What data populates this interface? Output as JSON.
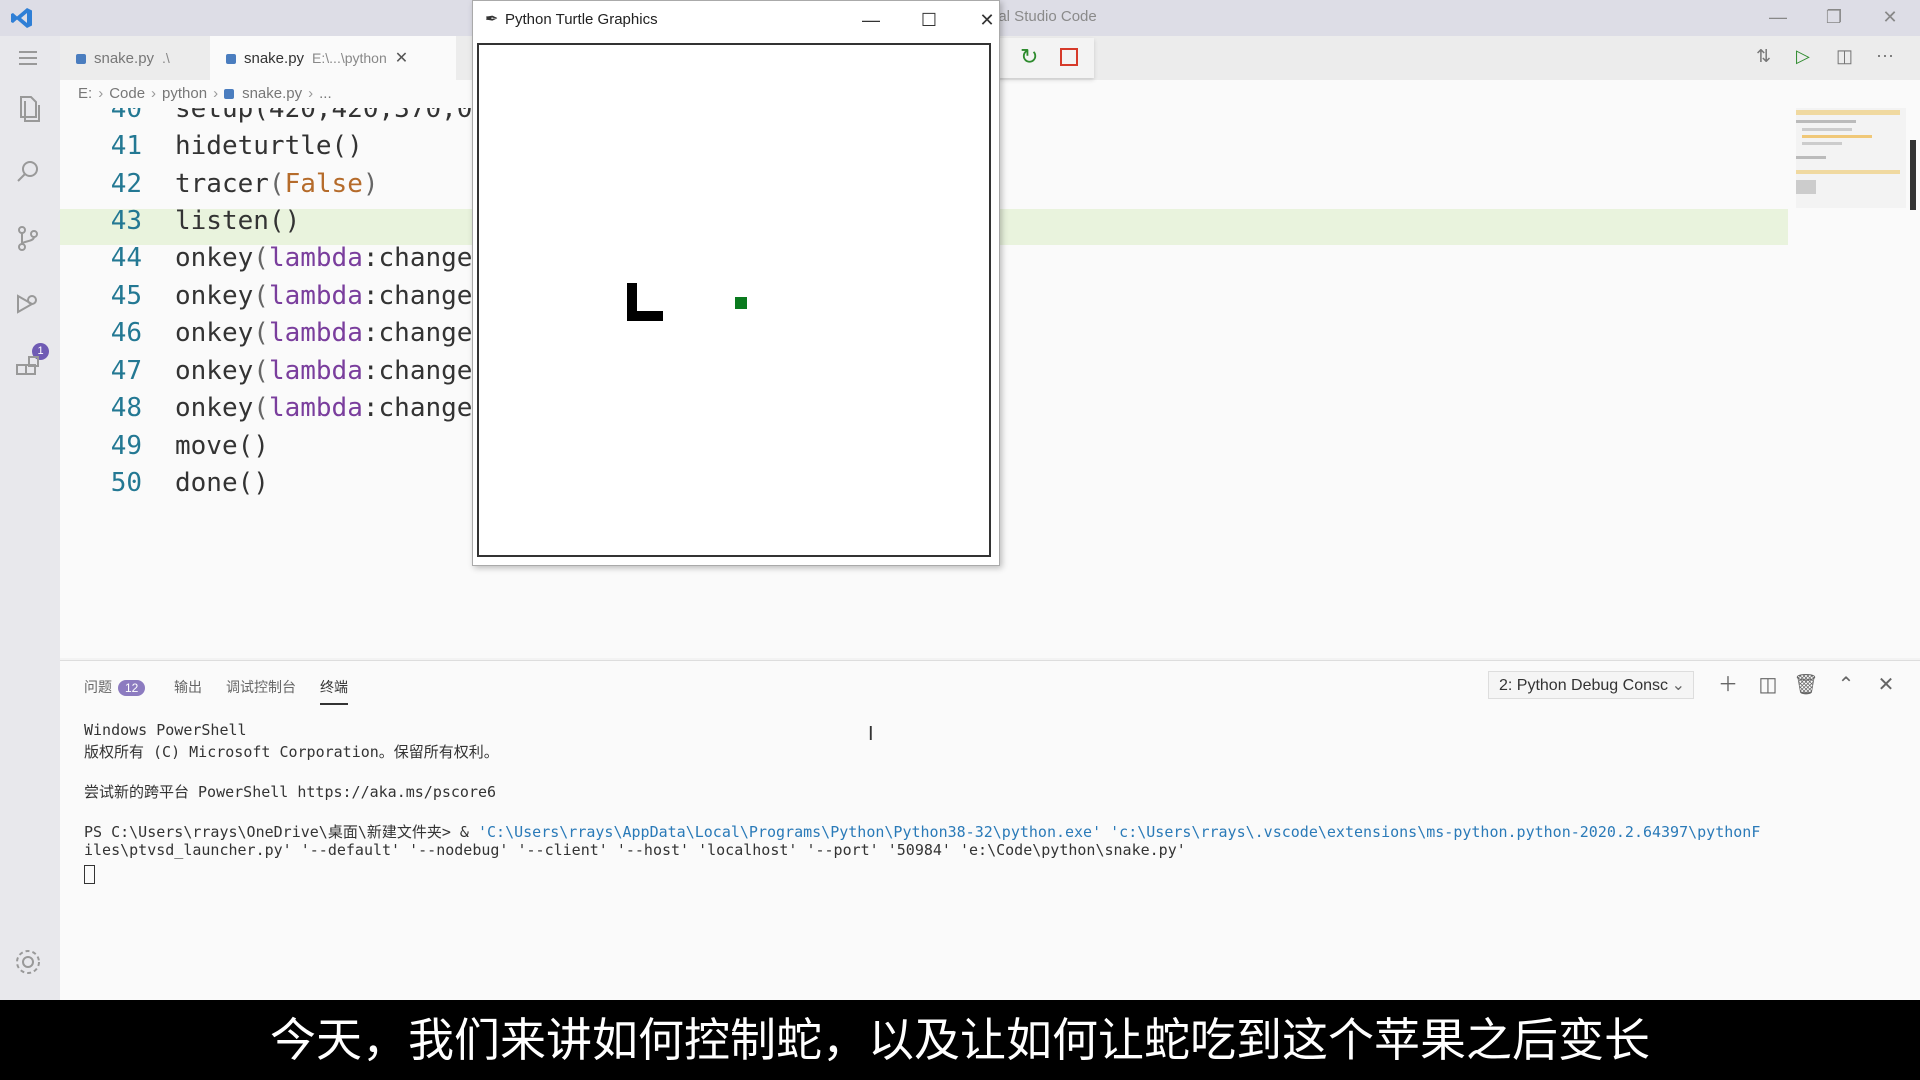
{
  "window": {
    "title": "ual Studio Code"
  },
  "tabs": [
    {
      "label": "snake.py",
      "desc": ".\\"
    },
    {
      "label": "snake.py",
      "desc": "E:\\...\\python"
    }
  ],
  "breadcrumb": [
    "E:",
    "Code",
    "python",
    "snake.py",
    "..."
  ],
  "editor": {
    "lines": [
      {
        "num": "40",
        "code": "setup(420,420,370,0)"
      },
      {
        "num": "41",
        "code": "hideturtle()"
      },
      {
        "num": "42",
        "fn": "tracer",
        "arg": "False"
      },
      {
        "num": "43",
        "code": "listen()"
      },
      {
        "num": "44",
        "fn": "onkey",
        "kw": "lambda",
        "rest": ":change("
      },
      {
        "num": "45",
        "fn": "onkey",
        "kw": "lambda",
        "rest": ":change("
      },
      {
        "num": "46",
        "fn": "onkey",
        "kw": "lambda",
        "rest": ":change("
      },
      {
        "num": "47",
        "fn": "onkey",
        "kw": "lambda",
        "rest": ":change("
      },
      {
        "num": "48",
        "fn": "onkey",
        "kw": "lambda",
        "rest": ":change("
      },
      {
        "num": "49",
        "code": "move()"
      },
      {
        "num": "50",
        "code": "done()"
      }
    ]
  },
  "turtle_window": {
    "title": "Python Turtle Graphics",
    "snake_color": "#000000",
    "apple_color": "#0a7a1e"
  },
  "panel": {
    "tabs": [
      {
        "label": "问题",
        "badge": "12"
      },
      {
        "label": "输出"
      },
      {
        "label": "调试控制台"
      },
      {
        "label": "终端"
      }
    ],
    "terminal_select": "2: Python Debug Consc",
    "terminal": {
      "line1": "Windows PowerShell",
      "line2": "版权所有 (C) Microsoft Corporation。保留所有权利。",
      "line3": "尝试新的跨平台 PowerShell https://aka.ms/pscore6",
      "prompt": "PS C:\\Users\\rrays\\OneDrive\\桌面\\新建文件夹> & ",
      "cmd1": "'C:\\Users\\rrays\\AppData\\Local\\Programs\\Python\\Python38-32\\python.exe' 'c:\\Users\\rrays\\.vscode\\extensions\\ms-python.python-2020.2.64397\\pythonF",
      "cmd2": "iles\\ptvsd_launcher.py' '--default' '--nodebug' '--client' '--host' 'localhost' '--port' '50984' 'e:\\Code\\python\\snake.py'"
    }
  },
  "activity": {
    "debug_badge": "1"
  },
  "subtitle": "今天，我们来讲如何控制蛇，以及让如何让蛇吃到这个苹果之后变长",
  "colors": {
    "accent": "#007acc",
    "line_highlight": "#e9f3dd",
    "debug_restart": "#2e8b2e",
    "debug_stop": "#d63a2a"
  }
}
